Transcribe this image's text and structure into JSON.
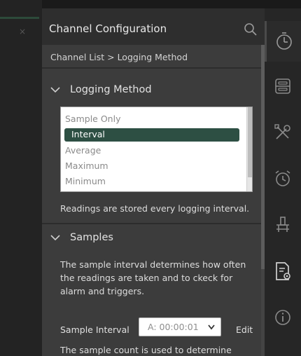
{
  "window": {
    "close_glyph": "×"
  },
  "header": {
    "title": "Channel Configuration",
    "search_icon": "search-icon"
  },
  "breadcrumb": "Channel List > Logging Method",
  "logging_method": {
    "heading": "Logging Method",
    "options": [
      "Sample Only",
      "Interval",
      "Average",
      "Maximum",
      "Minimum"
    ],
    "selected": "Interval",
    "description": "Readings are stored every logging interval."
  },
  "samples": {
    "heading": "Samples",
    "description_lines": [
      "The sample interval determines how often",
      "the readings are taken and to ckeck for",
      "alarm and triggers."
    ],
    "interval_label": "Sample Interval",
    "interval_value": "A: 00:00:01",
    "edit_label": "Edit",
    "count_text": "The sample count is used to determine"
  },
  "rail": {
    "items": [
      {
        "icon": "gauge-icon",
        "active": true
      },
      {
        "icon": "storage-icon",
        "active": false
      },
      {
        "icon": "tools-icon",
        "active": false
      },
      {
        "icon": "alarm-clock-icon",
        "active": false
      },
      {
        "icon": "probe-icon",
        "active": false
      },
      {
        "icon": "document-settings-icon",
        "active": false
      },
      {
        "icon": "info-icon",
        "active": false
      }
    ]
  },
  "colors": {
    "selection": "#2d4f43",
    "panel": "#3c3c3c",
    "header": "#2e2e2e",
    "rail": "#262626"
  }
}
